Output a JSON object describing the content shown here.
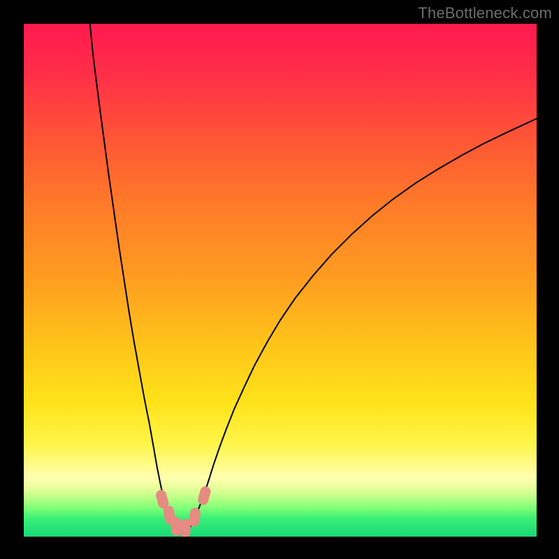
{
  "watermark": "TheBottleneck.com",
  "gradient_stops": [
    {
      "offset": 0.0,
      "color": "#ff1a4f"
    },
    {
      "offset": 0.1,
      "color": "#ff2f48"
    },
    {
      "offset": 0.22,
      "color": "#ff5436"
    },
    {
      "offset": 0.35,
      "color": "#ff7a29"
    },
    {
      "offset": 0.5,
      "color": "#ff9e20"
    },
    {
      "offset": 0.62,
      "color": "#ffc21a"
    },
    {
      "offset": 0.74,
      "color": "#ffe31a"
    },
    {
      "offset": 0.82,
      "color": "#fff54a"
    },
    {
      "offset": 0.885,
      "color": "#ffffb0"
    },
    {
      "offset": 0.905,
      "color": "#e8ff9b"
    },
    {
      "offset": 0.925,
      "color": "#b8ff86"
    },
    {
      "offset": 0.945,
      "color": "#7dff77"
    },
    {
      "offset": 0.965,
      "color": "#39ef76"
    },
    {
      "offset": 1.0,
      "color": "#18d877"
    }
  ],
  "chart_data": {
    "type": "line",
    "title": "",
    "xlabel": "",
    "ylabel": "",
    "xlim": [
      0,
      100
    ],
    "ylim": [
      0,
      100
    ],
    "x": [
      12.8,
      13.5,
      14.5,
      15.5,
      16.5,
      17.5,
      18.5,
      19.5,
      20.5,
      21.5,
      22.5,
      23.5,
      24.5,
      25.3,
      26.0,
      26.7,
      27.4,
      28.0,
      28.6,
      29.2,
      29.8,
      30.4,
      31.0,
      31.7,
      32.4,
      33.2,
      34.0,
      35.0,
      36.0,
      37.0,
      38.2,
      39.5,
      41.0,
      43.0,
      45.0,
      47.5,
      50.0,
      53.0,
      56.5,
      60.0,
      64.0,
      68.0,
      72.0,
      76.5,
      81.0,
      85.5,
      90.0,
      95.0,
      100.0
    ],
    "y": [
      101.0,
      94.0,
      86.0,
      78.5,
      71.0,
      64.0,
      57.0,
      50.5,
      44.0,
      38.0,
      32.5,
      27.0,
      22.0,
      17.5,
      13.5,
      10.0,
      7.0,
      4.7,
      3.0,
      1.8,
      1.0,
      0.6,
      0.6,
      1.0,
      1.8,
      3.2,
      5.2,
      7.8,
      10.8,
      14.0,
      17.5,
      21.0,
      24.8,
      29.2,
      33.4,
      38.0,
      42.2,
      46.6,
      51.0,
      55.0,
      59.0,
      62.6,
      65.8,
      69.0,
      71.8,
      74.4,
      76.8,
      79.2,
      81.5
    ],
    "markers": [
      {
        "x": 27.0,
        "y": 7.3
      },
      {
        "x": 28.4,
        "y": 4.2
      },
      {
        "x": 29.7,
        "y": 2.0
      },
      {
        "x": 31.5,
        "y": 1.6
      },
      {
        "x": 33.3,
        "y": 3.8
      },
      {
        "x": 35.2,
        "y": 8.0
      }
    ]
  },
  "colors": {
    "curve": "#000000",
    "marker_fill": "#e68a82",
    "frame": "#000000"
  }
}
